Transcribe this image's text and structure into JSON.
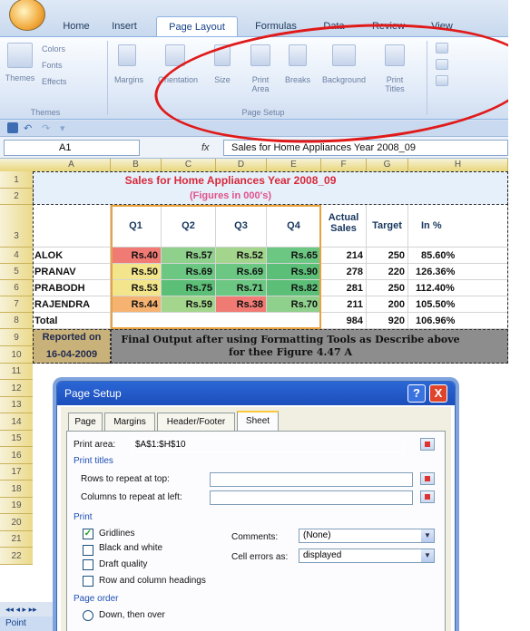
{
  "ribbon": {
    "tabs": [
      "Home",
      "Insert",
      "Page Layout",
      "Formulas",
      "Data",
      "Review",
      "View"
    ],
    "active_tab": "Page Layout",
    "themes_group": {
      "themes": "Themes",
      "colors": "Colors",
      "fonts": "Fonts",
      "effects": "Effects",
      "label": "Themes"
    },
    "page_setup": {
      "margins": "Margins",
      "orientation": "Orientation",
      "size": "Size",
      "print_area_1": "Print",
      "print_area_2": "Area",
      "breaks": "Breaks",
      "background": "Background",
      "print_titles_1": "Print",
      "print_titles_2": "Titles",
      "label": "Page Setup"
    }
  },
  "formula_bar": {
    "name_box": "A1",
    "fx": "fx",
    "content": "Sales for Home Appliances Year 2008_09"
  },
  "grid": {
    "columns": [
      "A",
      "B",
      "C",
      "D",
      "E",
      "F",
      "G",
      "H"
    ],
    "rows": [
      "1",
      "2",
      "3",
      "4",
      "5",
      "6",
      "7",
      "8",
      "9",
      "10",
      "11",
      "12",
      "13",
      "14",
      "15",
      "16",
      "17",
      "18",
      "19",
      "20",
      "21",
      "22"
    ],
    "title": "Sales for Home Appliances Year 2008_09",
    "subtitle": "(Figures in 000's)",
    "headers": {
      "q1": "Q1",
      "q2": "Q2",
      "q3": "Q3",
      "q4": "Q4",
      "actual1": "Actual",
      "actual2": "Sales",
      "target": "Target",
      "pct": "In %"
    },
    "data": [
      {
        "name": "ALOK",
        "q": [
          "Rs.40",
          "Rs.57",
          "Rs.52",
          "Rs.65"
        ],
        "actual": "214",
        "target": "250",
        "pct": "85.60%"
      },
      {
        "name": "PRANAV",
        "q": [
          "Rs.50",
          "Rs.69",
          "Rs.69",
          "Rs.90"
        ],
        "actual": "278",
        "target": "220",
        "pct": "126.36%"
      },
      {
        "name": "PRABODH",
        "q": [
          "Rs.53",
          "Rs.75",
          "Rs.71",
          "Rs.82"
        ],
        "actual": "281",
        "target": "250",
        "pct": "112.40%"
      },
      {
        "name": "RAJENDRA",
        "q": [
          "Rs.44",
          "Rs.59",
          "Rs.38",
          "Rs.70"
        ],
        "actual": "211",
        "target": "200",
        "pct": "105.50%"
      }
    ],
    "total": {
      "label": "Total",
      "actual": "984",
      "target": "920",
      "pct": "106.96%"
    },
    "reported_on": "Reported on",
    "date": "16-04-2009",
    "note": "Final Output after using Formatting Tools as Describe above for thee Figure 4.47 A"
  },
  "dialog": {
    "title": "Page Setup",
    "help": "?",
    "close": "X",
    "tabs": [
      "Page",
      "Margins",
      "Header/Footer",
      "Sheet"
    ],
    "active_tab": "Sheet",
    "print_area_label": "Print area:",
    "print_area_value": "$A$1:$H$10",
    "print_titles": "Print titles",
    "rows_repeat": "Rows to repeat at top:",
    "cols_repeat": "Columns to repeat at left:",
    "print_section": "Print",
    "gridlines": "Gridlines",
    "black_white": "Black and white",
    "draft": "Draft quality",
    "row_col_headings": "Row and column headings",
    "comments_label": "Comments:",
    "comments_value": "(None)",
    "cell_errors_label": "Cell errors as:",
    "cell_errors_value": "displayed",
    "page_order": "Page order",
    "down_then_over": "Down, then over"
  },
  "status": {
    "mode": "Point"
  },
  "colors": {
    "title_red": "#d8283a",
    "q_red": "#f07a74",
    "q_green": "#6cc783",
    "q_yellow": "#f3e58b",
    "q_orange": "#f6b271",
    "q_lightgreen": "#a3d68c"
  }
}
